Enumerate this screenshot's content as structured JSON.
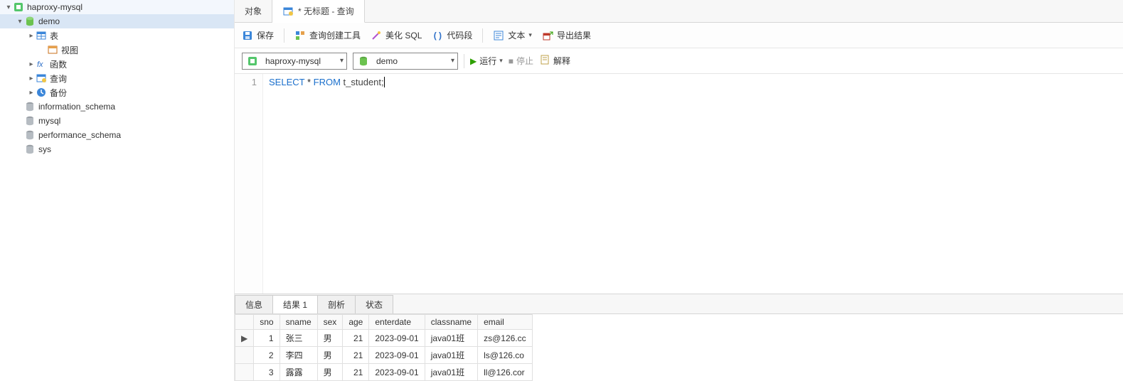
{
  "sidebar": {
    "connection": "haproxy-mysql",
    "active_db": "demo",
    "nodes": {
      "tables": "表",
      "views": "视图",
      "functions": "函数",
      "queries": "查询",
      "backups": "备份"
    },
    "other_dbs": [
      "information_schema",
      "mysql",
      "performance_schema",
      "sys"
    ]
  },
  "tabs": {
    "objects": "对象",
    "query": "* 无标题 - 查询"
  },
  "toolbar": {
    "save": "保存",
    "builder": "查询创建工具",
    "beautify": "美化 SQL",
    "snippet": "代码段",
    "text": "文本",
    "export": "导出结果"
  },
  "runbar": {
    "connection_value": "haproxy-mysql",
    "database_value": "demo",
    "run": "运行",
    "stop": "停止",
    "explain": "解释"
  },
  "editor": {
    "line_no": "1",
    "sql_kw_select": "SELECT",
    "sql_star": " * ",
    "sql_kw_from": "FROM",
    "sql_ident": " t_student;"
  },
  "result_tabs": {
    "info": "信息",
    "result1": "结果 1",
    "profile": "剖析",
    "status": "状态"
  },
  "grid": {
    "headers": [
      "sno",
      "sname",
      "sex",
      "age",
      "enterdate",
      "classname",
      "email"
    ],
    "rows": [
      {
        "ptr": "▶",
        "sno": "1",
        "sname": "张三",
        "sex": "男",
        "age": "21",
        "enterdate": "2023-09-01",
        "classname": "java01班",
        "email": "zs@126.cc"
      },
      {
        "ptr": "",
        "sno": "2",
        "sname": "李四",
        "sex": "男",
        "age": "21",
        "enterdate": "2023-09-01",
        "classname": "java01班",
        "email": "ls@126.co"
      },
      {
        "ptr": "",
        "sno": "3",
        "sname": "露露",
        "sex": "男",
        "age": "21",
        "enterdate": "2023-09-01",
        "classname": "java01班",
        "email": "ll@126.cor"
      }
    ]
  }
}
